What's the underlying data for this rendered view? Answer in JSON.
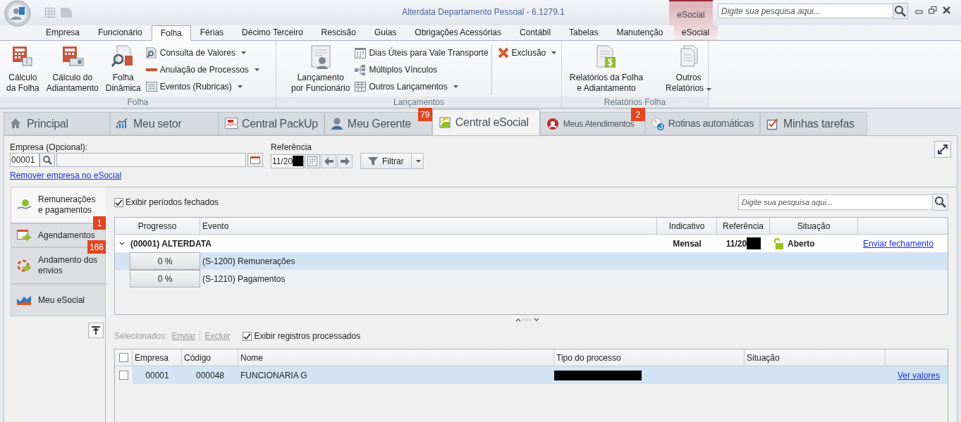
{
  "window": {
    "title": "Alterdata Departamento Pessoal - 6.1279.1",
    "contextual_group": "eSocial"
  },
  "search": {
    "placeholder": "Digite sua pesquisa aqui..."
  },
  "ribbon_tabs": [
    {
      "label": "Empresa",
      "selected": false
    },
    {
      "label": "Funcionário",
      "selected": false
    },
    {
      "label": "Folha",
      "selected": true
    },
    {
      "label": "Férias",
      "selected": false
    },
    {
      "label": "Décimo Terceiro",
      "selected": false
    },
    {
      "label": "Rescisão",
      "selected": false
    },
    {
      "label": "Guias",
      "selected": false
    },
    {
      "label": "Obrigações Acessórias",
      "selected": false
    },
    {
      "label": "Contábil",
      "selected": false
    },
    {
      "label": "Tabelas",
      "selected": false
    },
    {
      "label": "Manutenção",
      "selected": false
    },
    {
      "label": "eSocial",
      "selected": false,
      "kind": "contextual"
    }
  ],
  "ribbon_groups": [
    {
      "title": "Folha",
      "items": [
        {
          "kind": "large",
          "label": "Cálculo\nda Folha"
        },
        {
          "kind": "large",
          "label": "Cálculo do\nAdiantamento"
        },
        {
          "kind": "large",
          "label": "Folha\nDinâmica"
        },
        {
          "kind": "stack",
          "entries": [
            {
              "label": "Consulta de Valores",
              "dropdown": true
            },
            {
              "label": "Anulação de Processos",
              "dropdown": true
            },
            {
              "label": "Eventos (Rubricas)",
              "dropdown": true
            }
          ]
        }
      ]
    },
    {
      "title": "Lançamentos",
      "items": [
        {
          "kind": "large",
          "label": "Lançamento\npor Funcionário"
        },
        {
          "kind": "stack",
          "entries": [
            {
              "label": "Dias Úteis para Vale Transporte",
              "dropdown": false
            },
            {
              "label": "Múltiplos Vínculos",
              "dropdown": false
            },
            {
              "label": "Outros Lançamentos",
              "dropdown": true
            }
          ]
        },
        {
          "kind": "stack",
          "entries": [
            {
              "label": "Exclusão",
              "dropdown": true
            }
          ]
        }
      ]
    },
    {
      "title": "Relatórios Folha",
      "items": [
        {
          "kind": "large",
          "label": "Relatórios da Folha\ne Adiantamento"
        },
        {
          "kind": "large",
          "label": "Outros\nRelatórios",
          "dropdown": true
        }
      ]
    }
  ],
  "page_tabs": [
    {
      "label": "Principal",
      "selected": false
    },
    {
      "label": "Meu setor",
      "selected": false
    },
    {
      "label": "Central PackUp",
      "selected": false
    },
    {
      "label": "Meu Gerente",
      "selected": false,
      "badge": "79"
    },
    {
      "label": "Central eSocial",
      "selected": true
    },
    {
      "label": "Meus Atendimentos",
      "selected": false,
      "badge": "2"
    },
    {
      "label": "Rotinas automáticas",
      "selected": false
    },
    {
      "label": "Minhas tarefas",
      "selected": false
    }
  ],
  "filters": {
    "empresa_label": "Empresa (Opcional):",
    "empresa_code": "00001",
    "remove_link": "Remover empresa no eSocial",
    "referencia_label": "Referência",
    "referencia_value": "11/20",
    "filter_button": "Filtrar"
  },
  "side_nav": [
    {
      "label": "Remunerações e pagamentos",
      "selected": true
    },
    {
      "label": "Agendamentos",
      "selected": false,
      "badge": "1"
    },
    {
      "label": "Andamento dos envios",
      "selected": false,
      "badge": "166"
    },
    {
      "label": "Meu eSocial",
      "selected": false
    }
  ],
  "top_panel": {
    "show_closed": {
      "label": "Exibir períodos fechados",
      "checked": true
    },
    "search_placeholder": "Digite sua pesquisa aqui...",
    "columns": [
      "Progresso",
      "Evento",
      "Indicativo",
      "Referência",
      "Situação"
    ],
    "group": {
      "label": "(00001) ALTERDATA",
      "expanded": true,
      "indicativo": "Mensal",
      "referencia": "11/20",
      "situacao": "Aberto",
      "action": "Enviar fechamento",
      "rows": [
        {
          "progress": "0 %",
          "evento": "(S-1200) Remunerações",
          "selected": true
        },
        {
          "progress": "0 %",
          "evento": "(S-1210) Pagamentos",
          "selected": false
        }
      ]
    }
  },
  "bottom_panel": {
    "all_checked": false,
    "selected_label": "Selecionados:",
    "actions": [
      {
        "label": "Enviar",
        "disabled": true
      },
      {
        "label": "Excluir",
        "disabled": true
      }
    ],
    "show_processed": {
      "label": "Exibir registros processados",
      "checked": true
    },
    "columns": [
      "Empresa",
      "Código",
      "Nome",
      "Tipo do processo",
      "Situação"
    ],
    "rows": [
      {
        "checked": false,
        "selected": true,
        "empresa": "00001",
        "codigo": "000048",
        "nome": "FUNCIONARIA G",
        "action": "Ver valores"
      }
    ]
  }
}
